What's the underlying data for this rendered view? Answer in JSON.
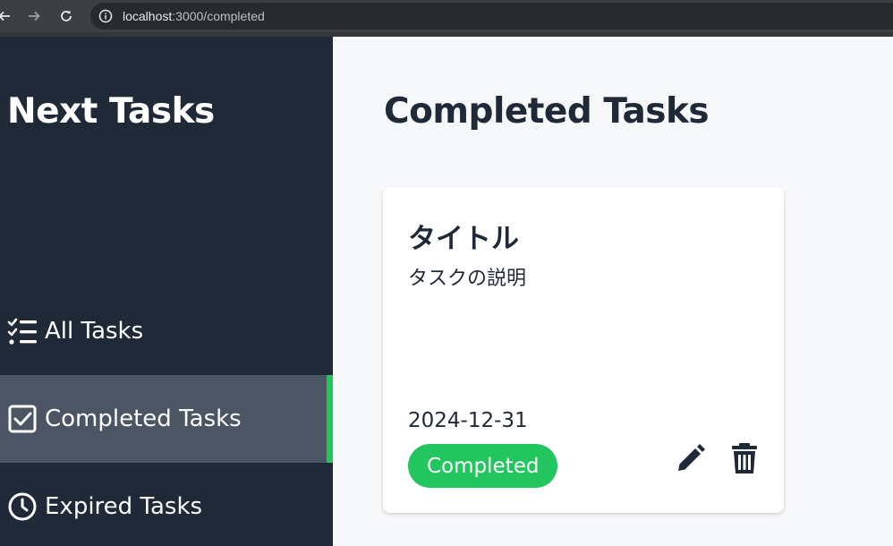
{
  "browser": {
    "url_host": "localhost",
    "url_rest": ":3000/completed"
  },
  "sidebar": {
    "app_title": "Next Tasks",
    "items": [
      {
        "label": "All Tasks",
        "icon": "checklist-icon"
      },
      {
        "label": "Completed Tasks",
        "icon": "checkbox-icon",
        "active": true
      },
      {
        "label": "Expired Tasks",
        "icon": "clock-icon"
      }
    ]
  },
  "main": {
    "title": "Completed Tasks",
    "tasks": [
      {
        "title": "タイトル",
        "description": "タスクの説明",
        "due_date": "2024-12-31",
        "status": "Completed"
      }
    ]
  },
  "colors": {
    "sidebar_bg": "#1f2937",
    "active_bg": "#4b5563",
    "accent": "#22c55e"
  }
}
